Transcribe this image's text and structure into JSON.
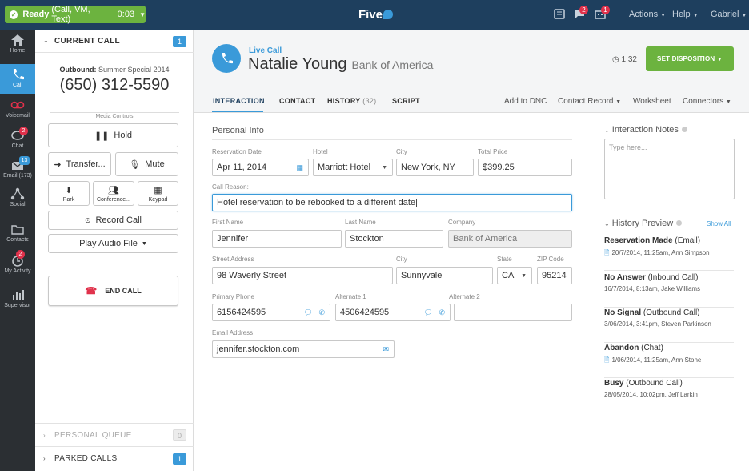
{
  "topbar": {
    "ready_status": "Ready",
    "ready_channels": "(Call, VM, Text)",
    "ready_timer": "0:03",
    "logo": "Five",
    "chat_badge": "2",
    "queue_badge": "1",
    "menu_actions": "Actions",
    "menu_help": "Help",
    "menu_user": "Gabriel"
  },
  "sidebar": {
    "items": [
      {
        "label": "Home"
      },
      {
        "label": "Call"
      },
      {
        "label": "Voicemail"
      },
      {
        "label": "Chat",
        "badge": "2"
      },
      {
        "label": "Email (173)",
        "badge": "13"
      },
      {
        "label": "Social"
      },
      {
        "label": "Contacts"
      },
      {
        "label": "My Activity",
        "badge": "2"
      },
      {
        "label": "Supervisor"
      }
    ]
  },
  "left_panel": {
    "current_call_title": "CURRENT CALL",
    "current_call_count": "1",
    "outbound_label": "Outbound:",
    "campaign": "Summer Special 2014",
    "phone_number": "(650) 312-5590",
    "media_controls_label": "Media Controls",
    "hold": "Hold",
    "transfer": "Transfer...",
    "mute": "Mute",
    "park": "Park",
    "conference": "Conference...",
    "keypad": "Keypad",
    "record_call": "Record Call",
    "play_audio": "Play Audio File",
    "end_call": "END CALL",
    "personal_queue_title": "PERSONAL QUEUE",
    "personal_queue_count": "0",
    "parked_calls_title": "PARKED CALLS",
    "parked_calls_count": "1"
  },
  "header": {
    "live_call": "Live Call",
    "contact_name": "Natalie Young",
    "company": "Bank of America",
    "call_timer": "1:32",
    "set_disposition": "SET DISPOSITION"
  },
  "tabs": {
    "interaction": "INTERACTION",
    "contact": "CONTACT",
    "history": "HISTORY",
    "history_count": "(32)",
    "script": "SCRIPT",
    "add_dnc": "Add to DNC",
    "contact_record": "Contact Record",
    "worksheet": "Worksheet",
    "connectors": "Connectors"
  },
  "form": {
    "section_title": "Personal Info",
    "reservation_date_label": "Reservation Date",
    "reservation_date": "Apr 11, 2014",
    "hotel_label": "Hotel",
    "hotel": "Marriott Hotel",
    "city_label": "City",
    "city": "New York, NY",
    "total_price_label": "Total Price",
    "total_price": "$399.25",
    "call_reason_label": "Call Reason:",
    "call_reason": "Hotel reservation to be rebooked to a different date",
    "first_name_label": "First Name",
    "first_name": "Jennifer",
    "last_name_label": "Last Name",
    "last_name": "Stockton",
    "company_label": "Company",
    "company": "Bank of America",
    "street_label": "Street Address",
    "street": "98 Waverly Street",
    "city2_label": "City",
    "city2": "Sunnyvale",
    "state_label": "State",
    "state": "CA",
    "zip_label": "ZIP Code",
    "zip": "95214",
    "primary_phone_label": "Primary Phone",
    "primary_phone": "6156424595",
    "alt1_label": "Alternate 1",
    "alt1": "4506424595",
    "alt2_label": "Alternate 2",
    "alt2": "",
    "email_label": "Email Address",
    "email": "jennifer.stockton.com"
  },
  "notes": {
    "title": "Interaction Notes",
    "placeholder": "Type here..."
  },
  "history_preview": {
    "title": "History Preview",
    "show_all": "Show All",
    "items": [
      {
        "title": "Reservation Made",
        "type": "(Email)",
        "date": "20/7/2014, 11:25am, Ann Simpson",
        "doc": true
      },
      {
        "title": "No Answer",
        "type": "(Inbound Call)",
        "date": "16/7/2014, 8:13am, Jake Williams",
        "doc": false
      },
      {
        "title": "No Signal",
        "type": "(Outbound Call)",
        "date": "3/06/2014, 3:41pm, Steven Parkinson",
        "doc": false
      },
      {
        "title": "Abandon",
        "type": "(Chat)",
        "date": "1/06/2014, 11:25am, Ann Stone",
        "doc": true
      },
      {
        "title": "Busy",
        "type": "(Outbound Call)",
        "date": "28/05/2014, 10:02pm, Jeff Larkin",
        "doc": false
      }
    ]
  },
  "colors": {
    "topbar": "#1e3f5e",
    "accent_blue": "#3a9ad9",
    "ready_green": "#6cb33f",
    "badge_red": "#e0314b",
    "sidebar": "#2b2f33"
  }
}
